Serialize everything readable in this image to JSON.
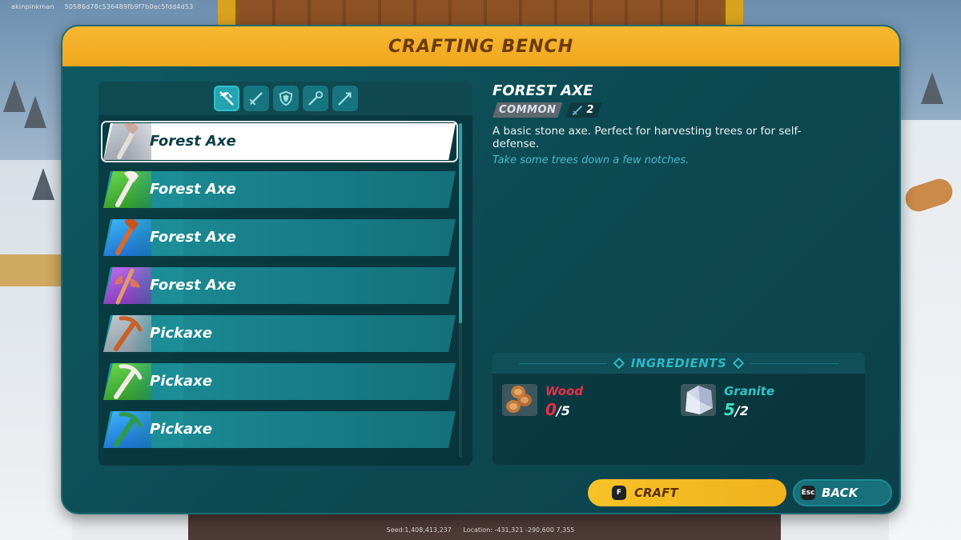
{
  "overlay": {
    "player": "akinpinkman",
    "session_id": "50586d78c536489fb9f7b0ec5fdd4d53",
    "seed": "Seed:1,408,413,237",
    "location": "Location: -431,321  -290,600  7,355"
  },
  "panel": {
    "title": "CRAFTING BENCH"
  },
  "tabs": [
    {
      "name": "tools",
      "icon": "pickaxe-axe-icon",
      "active": true
    },
    {
      "name": "weapons",
      "icon": "sword-icon",
      "active": false
    },
    {
      "name": "armor",
      "icon": "shield-icon",
      "active": false
    },
    {
      "name": "magic",
      "icon": "wand-icon",
      "active": false
    },
    {
      "name": "ranged",
      "icon": "arrow-icon",
      "active": false
    }
  ],
  "items": [
    {
      "label": "Forest Axe",
      "rarity": "common",
      "icon": "axe-icon",
      "selected": true
    },
    {
      "label": "Forest Axe",
      "rarity": "uncommon",
      "icon": "axe-icon",
      "selected": false
    },
    {
      "label": "Forest Axe",
      "rarity": "rare",
      "icon": "axe-icon",
      "selected": false
    },
    {
      "label": "Forest Axe",
      "rarity": "epic",
      "icon": "double-axe-icon",
      "selected": false
    },
    {
      "label": "Pickaxe",
      "rarity": "common",
      "icon": "pickaxe-icon",
      "selected": false
    },
    {
      "label": "Pickaxe",
      "rarity": "uncommon",
      "icon": "pickaxe-icon",
      "selected": false
    },
    {
      "label": "Pickaxe",
      "rarity": "rare",
      "icon": "pickaxe-icon",
      "selected": false
    }
  ],
  "detail": {
    "title": "FOREST AXE",
    "rarity": "COMMON",
    "level": "2",
    "description": "A basic stone axe. Perfect for harvesting trees or for self-defense.",
    "flavor": "Take some trees down a few notches."
  },
  "ingredients": {
    "title": "INGREDIENTS",
    "list": [
      {
        "name": "Wood",
        "have": "0",
        "need": "/5",
        "name_color": "#e8304a",
        "have_color": "#e8304a",
        "icon": "wood-logs-icon"
      },
      {
        "name": "Granite",
        "have": "5",
        "need": "/2",
        "name_color": "#34c4c7",
        "have_color": "#3de3c2",
        "icon": "granite-icon"
      }
    ]
  },
  "buttons": {
    "craft_key": "F",
    "craft_label": "CRAFT",
    "back_key": "Esc",
    "back_label": "BACK"
  },
  "colors": {
    "header": "#f1a71c",
    "panel": "#0f5a63",
    "accent": "#2fb7c4",
    "craft": "#f6c227"
  }
}
